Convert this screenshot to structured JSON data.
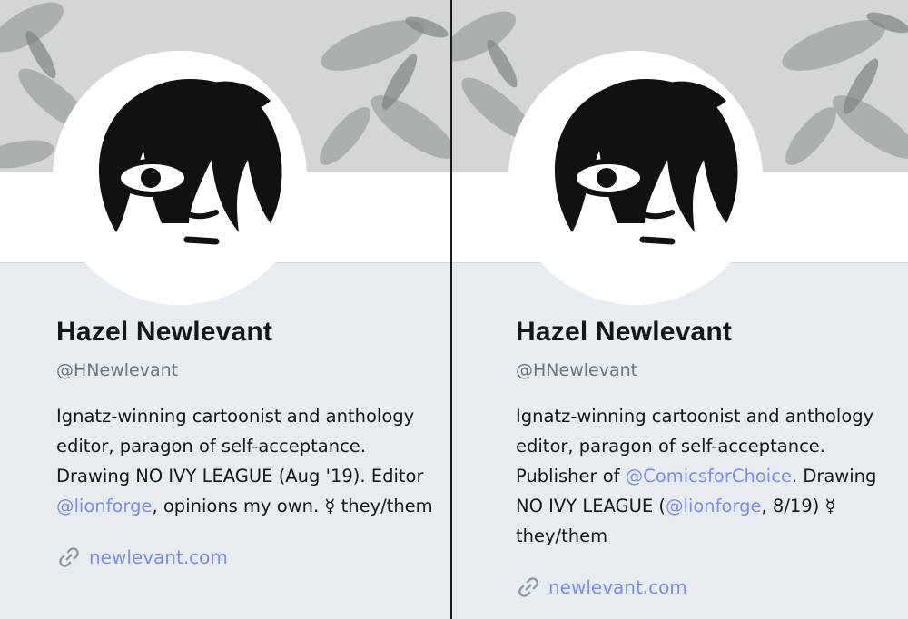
{
  "left": {
    "name": "Hazel Newlevant",
    "handle": "@HNewlevant",
    "bio": {
      "part1": "Ignatz-winning cartoonist and anthology editor, paragon of self-acceptance. Drawing NO IVY LEAGUE (Aug '19). Editor ",
      "mention": "@lionforge",
      "part2": ", opinions my own. ☿ they/them"
    },
    "url": "newlevant.com"
  },
  "right": {
    "name": "Hazel Newlevant",
    "handle": "@HNewlevant",
    "bio": {
      "part1": "Ignatz-winning cartoonist and anthology editor, paragon of self-acceptance. Publisher of ",
      "mention1": "@ComicsforChoice",
      "part2": ". Drawing NO IVY LEAGUE (",
      "mention2": "@lionforge",
      "part3": ", 8/19) ☿ they/them"
    },
    "url": "newlevant.com"
  },
  "icons": {
    "link": "link-icon",
    "avatar": "avatar-illustration",
    "banner": "foliage-banner"
  },
  "colors": {
    "background": "#e6ecf0",
    "link": "#7b8cf2",
    "handle": "#657786",
    "text": "#14171a"
  }
}
